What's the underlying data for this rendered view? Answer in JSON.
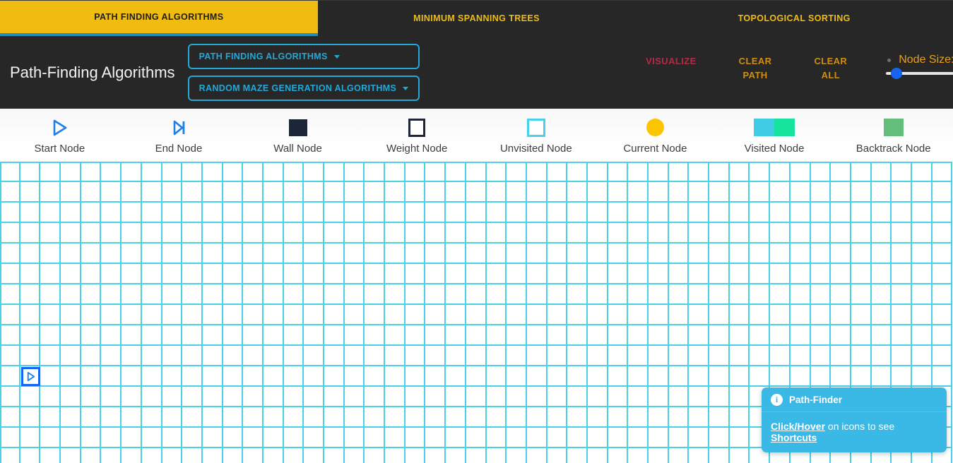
{
  "tabs": [
    {
      "label": "PATH FINDING ALGORITHMS",
      "active": true
    },
    {
      "label": "MINIMUM SPANNING TREES",
      "active": false
    },
    {
      "label": "TOPOLOGICAL SORTING",
      "active": false
    }
  ],
  "header": {
    "title": "Path-Finding Algorithms"
  },
  "dropdowns": [
    {
      "label": "PATH FINDING ALGORITHMS"
    },
    {
      "label": "RANDOM MAZE GENERATION ALGORITHMS"
    }
  ],
  "actions": [
    {
      "label": "VISUALIZE",
      "color": "#b32a46"
    },
    {
      "label": "CLEAR\nPATH",
      "color": "#cf8e16"
    },
    {
      "label": "CLEAR\nALL",
      "color": "#cf8e16"
    }
  ],
  "slider": {
    "label": "Node Size:",
    "value": 15,
    "min": 0,
    "max": 100,
    "thumb_color": "#1565f0",
    "track_color": "#e6e6e6"
  },
  "legend": [
    {
      "label": "Start Node",
      "icon": "play-triangle-outline-icon",
      "color": "#1f7fe8"
    },
    {
      "label": "End Node",
      "icon": "skip-forward-outline-icon",
      "color": "#1f7fe8"
    },
    {
      "label": "Wall Node",
      "icon": "filled-square-icon",
      "color": "#1d2636"
    },
    {
      "label": "Weight Node",
      "icon": "outlined-square-icon",
      "color": "#1d2636"
    },
    {
      "label": "Unvisited Node",
      "icon": "cyan-outlined-square-icon",
      "color": "#49d1ea"
    },
    {
      "label": "Current Node",
      "icon": "yellow-circle-icon",
      "color": "#fbc500"
    },
    {
      "label": "Visited Node",
      "icon": "two-tone-square-icon",
      "color": "#3fcce4",
      "color2": "#17e49c"
    },
    {
      "label": "Backtrack Node",
      "icon": "green-square-icon",
      "color": "#63be7b"
    }
  ],
  "grid": {
    "columns": 47,
    "rows": 15,
    "cell_size": 29,
    "line_color": "#49d1ea",
    "start_node": {
      "col": 1,
      "row": 10,
      "icon": "play-triangle-icon"
    },
    "end_node": {
      "col": 38,
      "row": 11,
      "icon": "skip-forward-icon"
    }
  },
  "toast": {
    "icon": "info-icon",
    "title": "Path-Finder",
    "body_link_1": "Click/Hover",
    "body_text": " on icons to see ",
    "body_link_2": "Shortcuts"
  }
}
